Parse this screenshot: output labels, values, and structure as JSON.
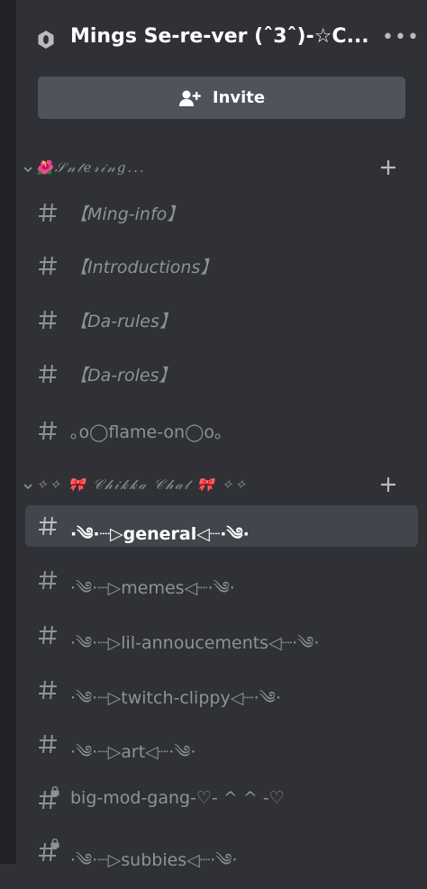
{
  "server": {
    "name": "Mings Se-re-ver (ˆ3ˆ)-☆C..."
  },
  "invite_button": {
    "label": "Invite"
  },
  "categories": [
    {
      "name": "🌺𝒮𝓃𝓉𝑒𝓇𝒾𝓃𝑔...",
      "channels": [
        {
          "name": "【Ming-info】",
          "italic": true,
          "locked": false,
          "selected": false
        },
        {
          "name": "【Introductions】",
          "italic": true,
          "locked": false,
          "selected": false
        },
        {
          "name": "【Da-rules】",
          "italic": true,
          "locked": false,
          "selected": false
        },
        {
          "name": "【Da-roles】",
          "italic": true,
          "locked": false,
          "selected": false
        },
        {
          "name": "｡o◯flame-on◯o｡",
          "italic": false,
          "locked": false,
          "selected": false
        }
      ]
    },
    {
      "name": "✧✧ 🎀 𝒞𝒽𝒾𝓀𝓀𝒶 𝒞𝒽𝒶𝓉 🎀 ✧✧",
      "channels": [
        {
          "name": "·༄·┈▷general◁┈·༄·",
          "italic": false,
          "locked": false,
          "selected": true
        },
        {
          "name": "·༄·┈▷memes◁┈·༄·",
          "italic": false,
          "locked": false,
          "selected": false
        },
        {
          "name": "·༄·┈▷lil-annoucements◁┈·༄·",
          "italic": false,
          "locked": false,
          "selected": false
        },
        {
          "name": "·༄·┈▷twitch-clippy◁┈·༄·",
          "italic": false,
          "locked": false,
          "selected": false
        },
        {
          "name": "·༄·┈▷art◁┈·༄·",
          "italic": false,
          "locked": false,
          "selected": false
        },
        {
          "name": "big-mod-gang-♡- ^ ^ -♡",
          "italic": false,
          "locked": true,
          "selected": false
        },
        {
          "name": "·༄·┈▷subbies◁┈·༄·",
          "italic": false,
          "locked": true,
          "selected": false
        }
      ]
    }
  ],
  "icons": {
    "server": "server-badge-icon",
    "more": "more-dots-icon",
    "invite": "add-person-icon",
    "chevron": "chevron-down-icon",
    "add": "plus-icon",
    "hash": "hash-icon",
    "lock": "lock-icon"
  },
  "colors": {
    "sidebar_bg": "#2f3136",
    "rail_bg": "#202225",
    "button_bg": "#4f545c",
    "selected_bg": "#42454b",
    "muted_text": "#8e9297",
    "white_text": "#ffffff"
  }
}
